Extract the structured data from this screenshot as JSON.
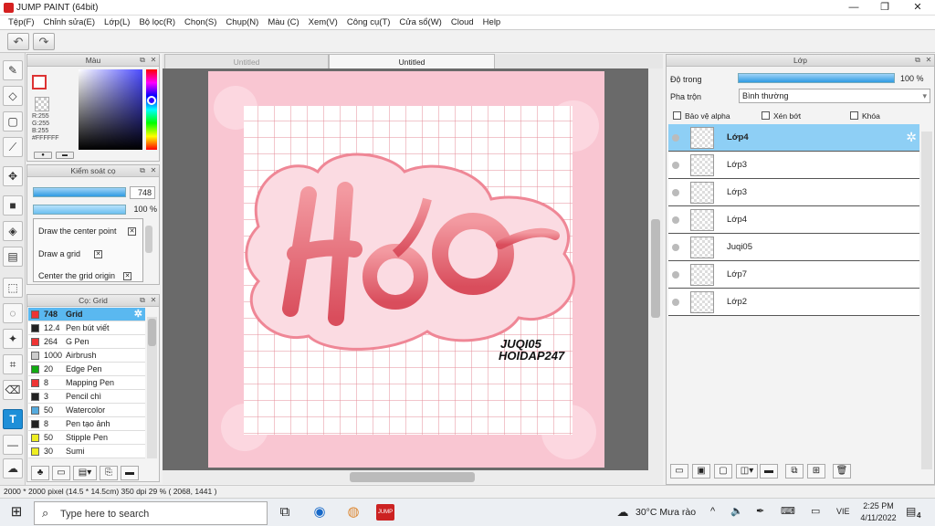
{
  "window": {
    "title": "JUMP PAINT (64bit)",
    "min": "—",
    "max": "❐",
    "close": "✕"
  },
  "menu": [
    "Tệp(F)",
    "Chỉnh sửa(E)",
    "Lớp(L)",
    "Bộ lọc(R)",
    "Chọn(S)",
    "Chụp(N)",
    "Màu (C)",
    "Xem(V)",
    "Công cụ(T)",
    "Cửa sổ(W)",
    "Cloud",
    "Help"
  ],
  "toolbar": {
    "undo": "↶",
    "redo": "↷"
  },
  "color_panel": {
    "title": "Màu",
    "r": "R:255",
    "g": "G:255",
    "b": "B:255",
    "hex": "#FFFFFF",
    "colors": {
      "fg_border": "#d33333",
      "hue_selected": "#3300ff"
    }
  },
  "brush_control": {
    "title": "Kiểm soát cọ",
    "size_value": "748",
    "opacity_value": "100 %",
    "opt1": "Draw the center point",
    "opt2": "Draw a grid",
    "opt3": "Center the grid origin"
  },
  "brush_panel": {
    "title": "Cọ: Grid",
    "brushes": [
      {
        "size": "748",
        "name": "Grid",
        "color": "#e33"
      },
      {
        "size": "12.4",
        "name": "Pen bút viết",
        "color": "#222"
      },
      {
        "size": "264",
        "name": "G Pen",
        "color": "#e33"
      },
      {
        "size": "1000",
        "name": "Airbrush",
        "color": "#ccc"
      },
      {
        "size": "20",
        "name": "Edge Pen",
        "color": "#1a1"
      },
      {
        "size": "8",
        "name": "Mapping Pen",
        "color": "#e33"
      },
      {
        "size": "3",
        "name": "Pencil chì",
        "color": "#222"
      },
      {
        "size": "50",
        "name": "Watercolor",
        "color": "#5ad"
      },
      {
        "size": "8",
        "name": "Pen tạo ảnh",
        "color": "#222"
      },
      {
        "size": "50",
        "name": "Stipple Pen",
        "color": "#ee2"
      },
      {
        "size": "30",
        "name": "Sumi",
        "color": "#ee2"
      }
    ]
  },
  "tabs": [
    "Untitled",
    "Untitled"
  ],
  "artwork": {
    "title_text": "Hảo",
    "sig1": "JUQI05",
    "sig2": "HOIDAP247"
  },
  "layer_panel": {
    "title": "Lớp",
    "opacity_label": "Độ trong",
    "opacity_value": "100 %",
    "blend_label": "Pha trộn",
    "blend_value": "Bình thường",
    "protect_alpha": "Bảo vệ alpha",
    "clip": "Xén bớt",
    "lock": "Khóa",
    "layers": [
      "Lớp4",
      "Lớp3",
      "Lớp3",
      "Lớp4",
      "Juqi05",
      "Lớp7",
      "Lớp2"
    ]
  },
  "status": {
    "text": "2000 * 2000 pixel  (14.5 * 14.5cm)  350 dpi  29 %  ( 2068, 1441 )"
  },
  "taskbar": {
    "search_placeholder": "Type here to search",
    "weather": "30°C Mưa rào",
    "lang": "VIE",
    "time": "2:25 PM",
    "date": "4/11/2022",
    "notif": "4"
  }
}
